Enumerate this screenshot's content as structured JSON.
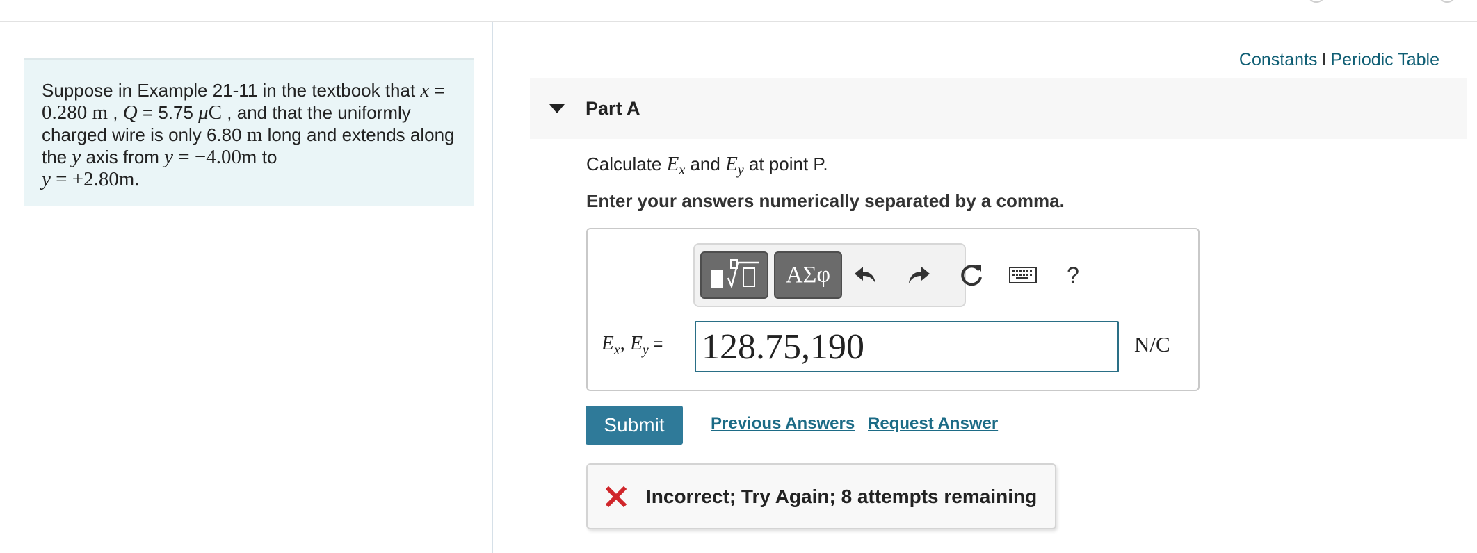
{
  "problem": {
    "t1": "Suppose in Example 21-11 in the textbook that ",
    "v_x": "x",
    "t2": " = ",
    "v_x_val": "0.280 m",
    "t3": " , ",
    "v_Q": "Q",
    "t4": " = 5.75 ",
    "v_mu": "μ",
    "v_C": "C",
    "t5": " , and that the uniformly charged wire is only 6.80 ",
    "v_m": "m",
    "t6": " long and extends along the ",
    "v_y1": "y",
    "t7": " axis from ",
    "v_y2": "y",
    "t8": " = −4.00m",
    "t9": " to ",
    "v_y3": "y",
    "t10": " = +2.80m."
  },
  "links": {
    "constants": "Constants",
    "separator": "I",
    "periodic_table": "Periodic Table"
  },
  "part": {
    "title": "Part A",
    "question_prefix": "Calculate ",
    "ex": "E",
    "ex_sub": "x",
    "question_and": " and ",
    "ey": "E",
    "ey_sub": "y",
    "question_suffix": " at point P.",
    "instruction": "Enter your answers numerically separated by a comma."
  },
  "toolbar": {
    "templates_icon": "templates-icon",
    "symbols_label": "ΑΣφ",
    "help_label": "?"
  },
  "answer": {
    "label_e1": "E",
    "label_s1": "x",
    "label_comma": ", ",
    "label_e2": "E",
    "label_s2": "y",
    "label_eq": " =",
    "value": "128.75,190",
    "unit": "N/C"
  },
  "actions": {
    "submit": "Submit",
    "previous_answers": "Previous Answers",
    "request_answer": "Request Answer"
  },
  "feedback": {
    "text": "Incorrect; Try Again; 8 attempts remaining",
    "icon_color": "#d0262b"
  },
  "colors": {
    "accent": "#2f7a99",
    "link": "#1c6b86",
    "problem_bg": "#eaf5f7"
  }
}
